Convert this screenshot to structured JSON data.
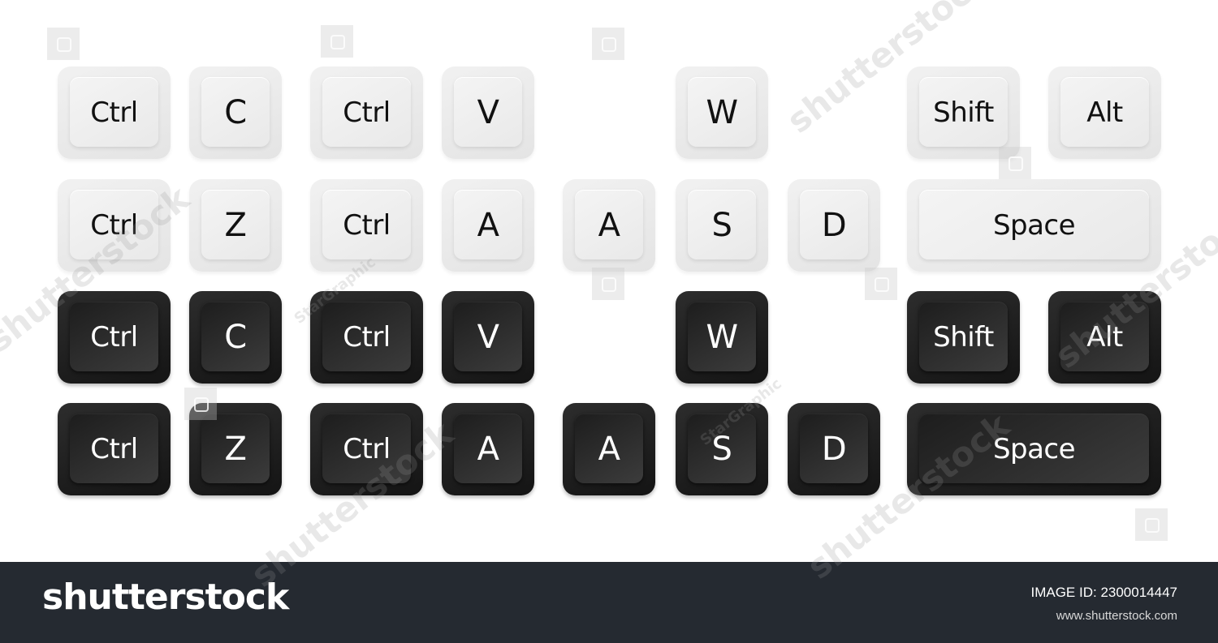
{
  "keys": {
    "light": {
      "row1": [
        "Ctrl",
        "C",
        "Ctrl",
        "V",
        "W",
        "Shift",
        "Alt"
      ],
      "row2": [
        "Ctrl",
        "Z",
        "Ctrl",
        "A",
        "A",
        "S",
        "D",
        "Space"
      ]
    },
    "dark": {
      "row1": [
        "Ctrl",
        "C",
        "Ctrl",
        "V",
        "W",
        "Shift",
        "Alt"
      ],
      "row2": [
        "Ctrl",
        "Z",
        "Ctrl",
        "A",
        "A",
        "S",
        "D",
        "Space"
      ]
    }
  },
  "colors": {
    "light_key": "#e8e8e8",
    "dark_key": "#1c1c1c",
    "footer_background": "#252a31"
  },
  "watermarks": {
    "brand": "shutterstock",
    "contributor": "StarGraphic"
  },
  "footer": {
    "logo": "shutterstock",
    "image_id": "IMAGE ID: 2300014447",
    "url": "www.shutterstock.com"
  }
}
